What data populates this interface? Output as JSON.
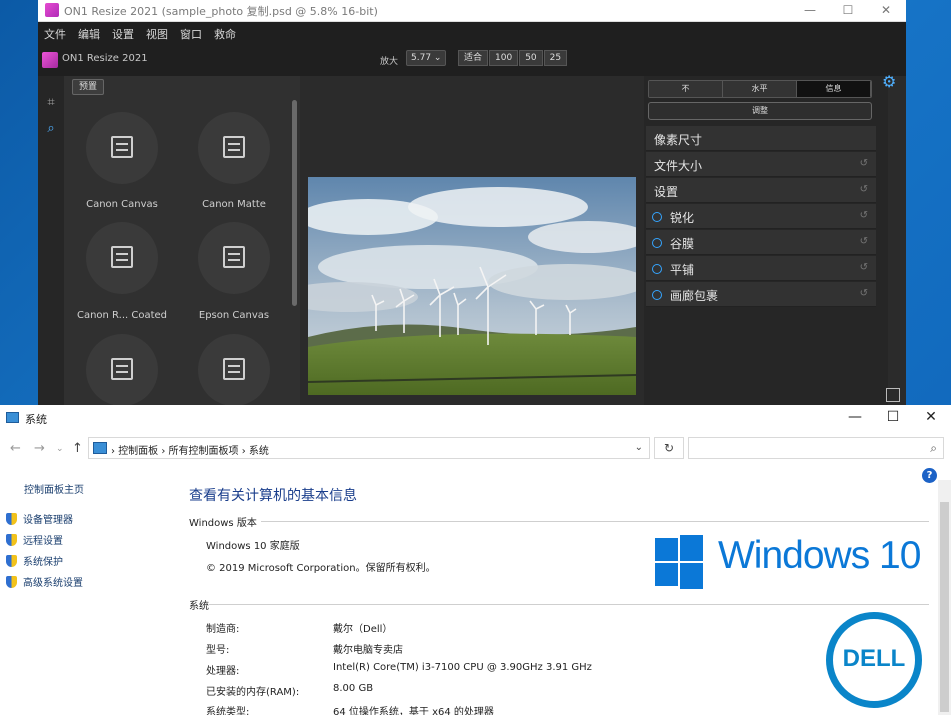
{
  "on1": {
    "title": "ON1 Resize 2021 (sample_photo 复制.psd @ 5.8% 16-bit)",
    "menu": [
      "文件",
      "编辑",
      "设置",
      "视图",
      "窗口",
      "救命"
    ],
    "app_name": "ON1 Resize 2021",
    "zoom_label": "放大",
    "zoom_value": "5.77",
    "zoom_buttons": [
      "适合",
      "100",
      "50",
      "25"
    ],
    "preset_tag": "预置",
    "presets": [
      "Canon Canvas",
      "Canon Matte",
      "Canon R... Coated",
      "Epson Canvas",
      "",
      ""
    ],
    "segments": [
      "不",
      "水平",
      "信息"
    ],
    "adjust_label": "调整",
    "sections": [
      {
        "label": "像素尺寸"
      },
      {
        "label": "文件大小"
      },
      {
        "label": "设置"
      },
      {
        "label": "锐化"
      },
      {
        "label": "谷膜"
      },
      {
        "label": "平铺"
      },
      {
        "label": "画廊包裹"
      }
    ]
  },
  "system": {
    "title": "系统",
    "breadcrumbs": [
      "控制面板",
      "所有控制面板项",
      "系统"
    ],
    "sidebar": {
      "home": "控制面板主页",
      "links": [
        "设备管理器",
        "远程设置",
        "系统保护",
        "高级系统设置"
      ]
    },
    "heading": "查看有关计算机的基本信息",
    "edition_group": "Windows 版本",
    "edition": "Windows 10 家庭版",
    "copyright": "© 2019 Microsoft Corporation。保留所有权利。",
    "windows_brand": "Windows 10",
    "system_group": "系统",
    "rows": [
      {
        "label": "制造商:",
        "value": "戴尔（Dell）"
      },
      {
        "label": "型号:",
        "value": "戴尔电脑专卖店"
      },
      {
        "label": "处理器:",
        "value": "Intel(R) Core(TM) i3-7100 CPU @ 3.90GHz   3.91 GHz"
      },
      {
        "label": "已安装的内存(RAM):",
        "value": "8.00 GB"
      },
      {
        "label": "系统类型:",
        "value": "64 位操作系统，基于 x64 的处理器"
      }
    ],
    "dell_logo": "DELL"
  },
  "colors": {
    "accent": "#0b78d7",
    "on1_bg": "#2b2b2b",
    "link": "#1a3e6e"
  }
}
